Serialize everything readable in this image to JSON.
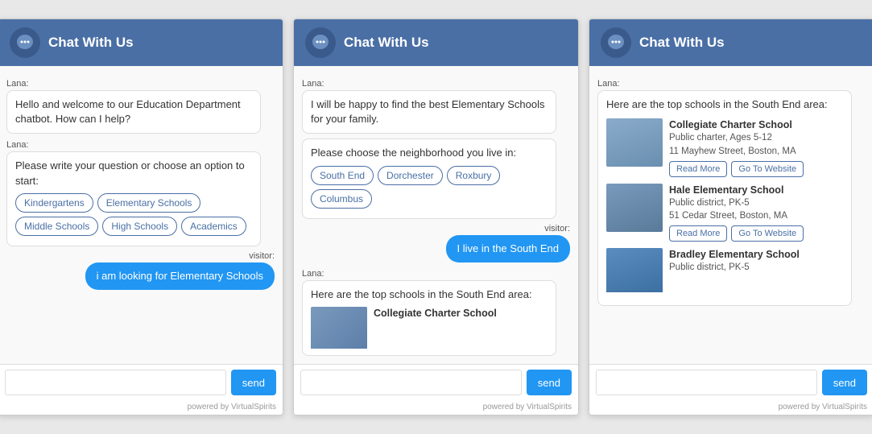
{
  "widget1": {
    "header": {
      "title": "Chat With Us"
    },
    "lana_label1": "Lana:",
    "msg1": "Hello and welcome to our Education Department chatbot. How can I help?",
    "lana_label2": "Lana:",
    "msg2": "Please write your question or choose an option to start:",
    "options": [
      "Kindergartens",
      "Elementary Schools",
      "Middle Schools",
      "High Schools",
      "Academics"
    ],
    "visitor_label": "visitor:",
    "visitor_msg": "i am looking for Elementary Schools",
    "send_label": "send",
    "powered": "powered by VirtualSpirits"
  },
  "widget2": {
    "header": {
      "title": "Chat With Us"
    },
    "lana_label1": "Lana:",
    "msg1": "I will be happy to find the best Elementary Schools for your family.",
    "msg2": "Please choose the neighborhood you live in:",
    "neighborhood_options": [
      "South End",
      "Dorchester",
      "Roxbury",
      "Columbus"
    ],
    "visitor_label": "visitor:",
    "visitor_msg": "I live in the South End",
    "lana_label2": "Lana:",
    "msg3": "Here are the top schools in the South End area:",
    "partial_school_name": "Collegiate Charter School",
    "send_label": "send",
    "powered": "powered by VirtualSpirits"
  },
  "widget3": {
    "header": {
      "title": "Chat With Us"
    },
    "lana_label": "Lana:",
    "intro": "Here are the top schools in the South End area:",
    "schools": [
      {
        "name": "Collegiate Charter School",
        "type": "Public charter, Ages 5-12",
        "address": "11 Mayhew Street, Boston, MA",
        "read_more": "Read More",
        "go_to": "Go To Website"
      },
      {
        "name": "Hale Elementary School",
        "type": "Public district, PK-5",
        "address": "51 Cedar Street, Boston, MA",
        "read_more": "Read More",
        "go_to": "Go To Website"
      },
      {
        "name": "Bradley Elementary School",
        "type": "Public district, PK-5",
        "address": "",
        "read_more": "",
        "go_to": ""
      }
    ],
    "send_label": "send",
    "powered": "powered by VirtualSpirits"
  }
}
